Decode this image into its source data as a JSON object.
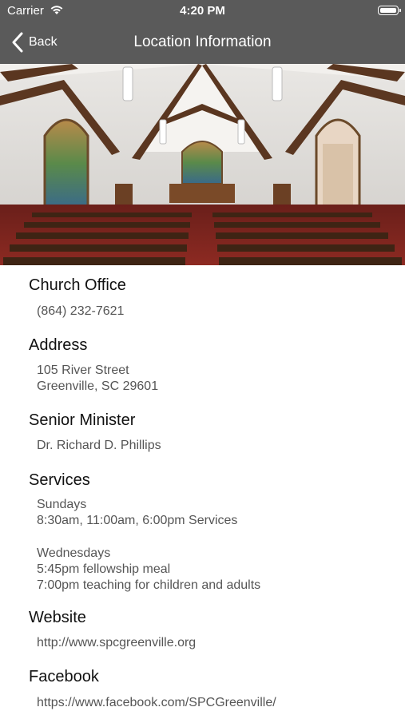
{
  "status_bar": {
    "carrier": "Carrier",
    "time": "4:20 PM"
  },
  "nav": {
    "back_label": "Back",
    "title": "Location Information"
  },
  "colors": {
    "header_bg": "#5a5a5a",
    "title_text": "#111111",
    "body_text": "#555555"
  },
  "sections": {
    "office": {
      "title": "Church Office",
      "phone": "(864) 232-7621"
    },
    "address": {
      "title": "Address",
      "line1": "105 River Street",
      "line2": "Greenville, SC 29601"
    },
    "minister": {
      "title": "Senior Minister",
      "name": "Dr. Richard D. Phillips"
    },
    "services": {
      "title": "Services",
      "sunday_label": "Sundays",
      "sunday_times": "8:30am, 11:00am, 6:00pm Services",
      "wednesday_label": "Wednesdays",
      "wednesday_meal": "5:45pm fellowship meal",
      "wednesday_teaching": "7:00pm teaching for children and adults"
    },
    "website": {
      "title": "Website",
      "url": "http://www.spcgreenville.org"
    },
    "facebook": {
      "title": "Facebook",
      "url": "https://www.facebook.com/SPCGreenville/"
    }
  }
}
